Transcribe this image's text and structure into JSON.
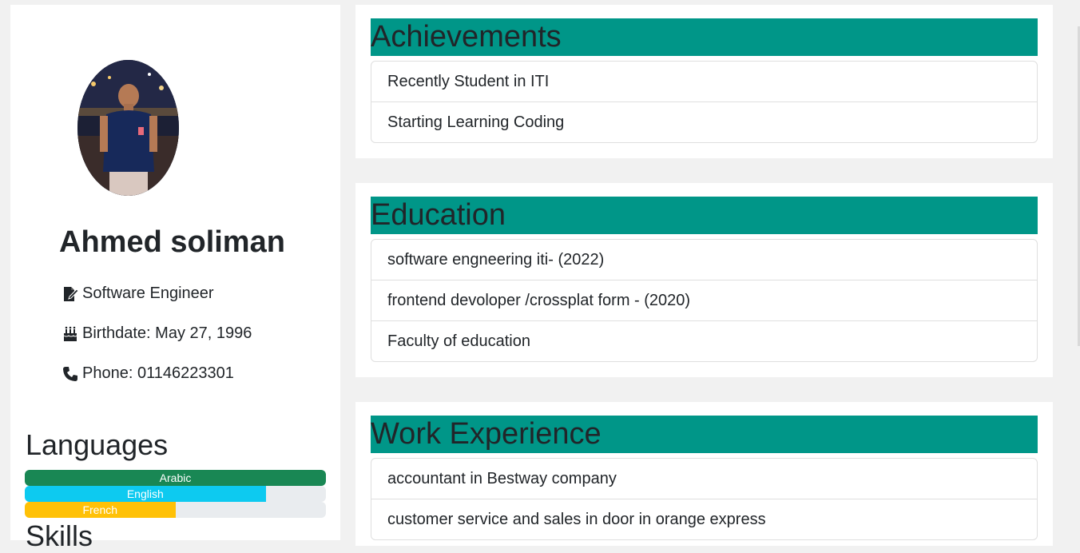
{
  "profile": {
    "name": "Ahmed soliman",
    "job": "Software Engineer",
    "birthdate": "Birthdate: May 27, 1996",
    "phone": "Phone: 01146223301"
  },
  "languages": {
    "title": "Languages",
    "items": [
      {
        "label": "Arabic",
        "percent": 100,
        "color": "#198754"
      },
      {
        "label": "English",
        "percent": 80,
        "color": "#0dcaf0"
      },
      {
        "label": "French",
        "percent": 50,
        "color": "#ffc107"
      }
    ]
  },
  "skills": {
    "title": "Skills"
  },
  "sections": {
    "achievements": {
      "title": "Achievements",
      "items": [
        "Recently Student in ITI",
        "Starting Learning Coding"
      ]
    },
    "education": {
      "title": "Education",
      "items": [
        "software engneering iti- (2022)",
        "frontend devoloper /crossplat form - (2020)",
        "Faculty of education"
      ]
    },
    "work": {
      "title": "Work Experience",
      "items": [
        "accountant in Bestway company",
        "customer service and sales in door in orange express"
      ]
    }
  },
  "colors": {
    "section_header": "#009688",
    "page_background": "#f1f1f1"
  },
  "icons": {
    "job": "file-signature-icon",
    "birthdate": "birthday-cake-icon",
    "phone": "phone-icon"
  }
}
